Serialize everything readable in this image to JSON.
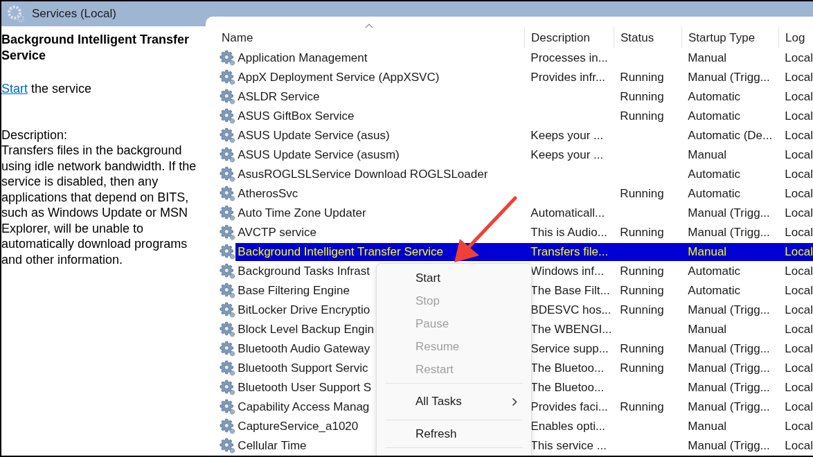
{
  "window": {
    "title": "Services (Local)"
  },
  "details": {
    "title": "Background Intelligent Transfer Service",
    "action_link": "Start",
    "action_text": "the service",
    "description_label": "Description:",
    "description": "Transfers files in the background using idle network bandwidth. If the service is disabled, then any applications that depend on BITS, such as Windows Update or MSN Explorer, will be unable to automatically download programs and other information."
  },
  "table": {
    "columns": [
      "Name",
      "Description",
      "Status",
      "Startup Type",
      "Log"
    ],
    "rows": [
      {
        "name": "Application Management",
        "description": "Processes in...",
        "status": "",
        "startup_type": "Manual",
        "log_on": "Local",
        "selected": false
      },
      {
        "name": "AppX Deployment Service (AppXSVC)",
        "description": "Provides infr...",
        "status": "Running",
        "startup_type": "Manual (Trigg...",
        "log_on": "Local",
        "selected": false
      },
      {
        "name": "ASLDR Service",
        "description": "",
        "status": "Running",
        "startup_type": "Automatic",
        "log_on": "Local",
        "selected": false
      },
      {
        "name": "ASUS GiftBox Service",
        "description": "",
        "status": "Running",
        "startup_type": "Automatic",
        "log_on": "Local",
        "selected": false
      },
      {
        "name": "ASUS Update Service (asus)",
        "description": "Keeps your ...",
        "status": "",
        "startup_type": "Automatic (De...",
        "log_on": "Local",
        "selected": false
      },
      {
        "name": "ASUS Update Service (asusm)",
        "description": "Keeps your ...",
        "status": "",
        "startup_type": "Manual",
        "log_on": "Local",
        "selected": false
      },
      {
        "name": "AsusROGLSLService Download ROGLSLoader",
        "description": "",
        "status": "",
        "startup_type": "Automatic",
        "log_on": "Local",
        "selected": false
      },
      {
        "name": "AtherosSvc",
        "description": "",
        "status": "Running",
        "startup_type": "Automatic",
        "log_on": "Local",
        "selected": false
      },
      {
        "name": "Auto Time Zone Updater",
        "description": "Automaticall...",
        "status": "",
        "startup_type": "Manual (Trigg...",
        "log_on": "Local",
        "selected": false
      },
      {
        "name": "AVCTP service",
        "description": "This is Audio...",
        "status": "Running",
        "startup_type": "Manual (Trigg...",
        "log_on": "Local",
        "selected": false
      },
      {
        "name": "Background Intelligent Transfer Service",
        "description": "Transfers file...",
        "status": "",
        "startup_type": "Manual",
        "log_on": "Local",
        "selected": true
      },
      {
        "name": "Background Tasks Infrast",
        "description": "Windows inf...",
        "status": "Running",
        "startup_type": "Automatic",
        "log_on": "Local",
        "selected": false
      },
      {
        "name": "Base Filtering Engine",
        "description": "The Base Filt...",
        "status": "Running",
        "startup_type": "Automatic",
        "log_on": "Local",
        "selected": false
      },
      {
        "name": "BitLocker Drive Encryptio",
        "description": "BDESVC hos...",
        "status": "Running",
        "startup_type": "Manual (Trigg...",
        "log_on": "Local",
        "selected": false
      },
      {
        "name": "Block Level Backup Engin",
        "description": "The WBENGI...",
        "status": "",
        "startup_type": "Manual",
        "log_on": "Local",
        "selected": false
      },
      {
        "name": "Bluetooth Audio Gateway",
        "description": "Service supp...",
        "status": "Running",
        "startup_type": "Manual (Trigg...",
        "log_on": "Local",
        "selected": false
      },
      {
        "name": "Bluetooth Support Servic",
        "description": "The Bluetoo...",
        "status": "Running",
        "startup_type": "Manual (Trigg...",
        "log_on": "Local",
        "selected": false
      },
      {
        "name": "Bluetooth User Support S",
        "description": "The Bluetoo...",
        "status": "",
        "startup_type": "Manual (Trigg...",
        "log_on": "Local",
        "selected": false
      },
      {
        "name": "Capability Access Manag",
        "description": "Provides faci...",
        "status": "Running",
        "startup_type": "Manual (Trigg...",
        "log_on": "Local",
        "selected": false
      },
      {
        "name": "CaptureService_a1020",
        "description": "Enables opti...",
        "status": "",
        "startup_type": "Manual",
        "log_on": "Local",
        "selected": false
      },
      {
        "name": "Cellular Time",
        "description": "This service ...",
        "status": "",
        "startup_type": "Manual (Trigg...",
        "log_on": "Local",
        "selected": false
      }
    ]
  },
  "context_menu": {
    "items": [
      {
        "kind": "item",
        "label": "Start",
        "disabled": false
      },
      {
        "kind": "item",
        "label": "Stop",
        "disabled": true
      },
      {
        "kind": "item",
        "label": "Pause",
        "disabled": true
      },
      {
        "kind": "item",
        "label": "Resume",
        "disabled": true
      },
      {
        "kind": "item",
        "label": "Restart",
        "disabled": true
      },
      {
        "kind": "separator"
      },
      {
        "kind": "submenu",
        "label": "All Tasks",
        "disabled": false
      },
      {
        "kind": "separator"
      },
      {
        "kind": "item",
        "label": "Refresh",
        "disabled": false
      },
      {
        "kind": "separator"
      }
    ]
  }
}
